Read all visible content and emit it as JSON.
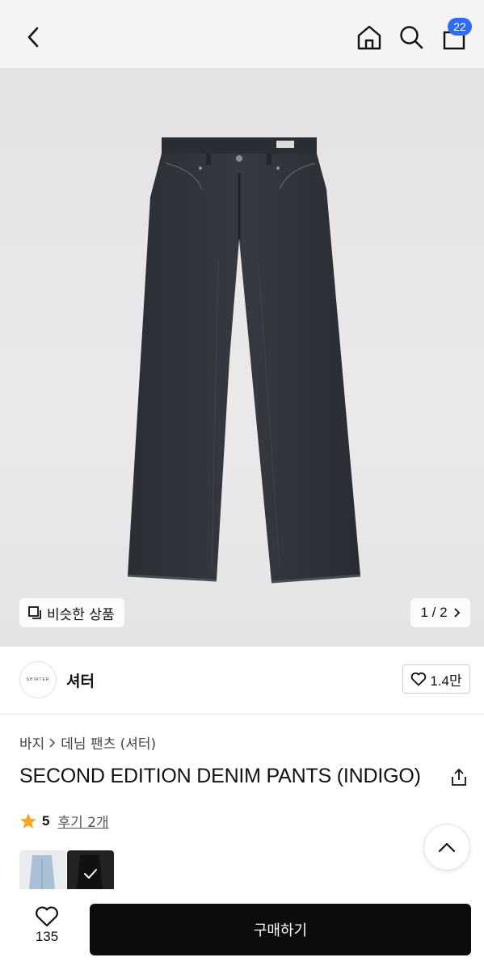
{
  "header": {
    "back_icon": "chevron-left-icon",
    "home_icon": "home-icon",
    "search_icon": "search-icon",
    "cart_icon": "shopping-bag-icon",
    "cart_count": "22",
    "badge_color": "#2f6cf6"
  },
  "gallery": {
    "similar_label": "비슷한 상품",
    "pager_text": "1 / 2"
  },
  "brand": {
    "logo_text": "SHIRTER",
    "name": "셔터",
    "likes": "1.4만"
  },
  "product": {
    "breadcrumb": [
      "바지",
      "데님 팬츠 (셔터)"
    ],
    "title": "SECOND EDITION DENIM PANTS (INDIGO)",
    "rating": "5",
    "reviews": "후기 2개"
  },
  "bottom": {
    "wish_count": "135",
    "buy_label": "구매하기",
    "buy_color": "#0c0c0c"
  }
}
